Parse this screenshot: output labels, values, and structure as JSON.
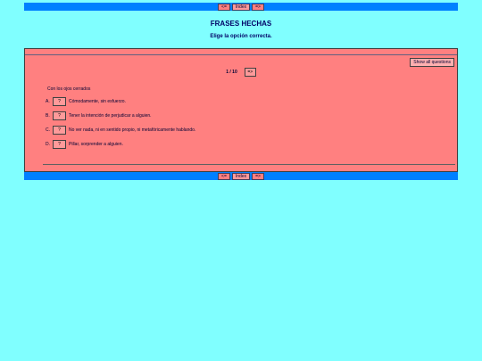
{
  "nav": {
    "prev_label": "<=",
    "index_label": "Index",
    "next_label": "=>"
  },
  "header": {
    "title": "FRASES HECHAS",
    "instruction": "Elige la opción correcta."
  },
  "quiz": {
    "show_all_label": "Show all questions",
    "counter": "1 / 10",
    "next_label": "=>",
    "question": "Con los ojos cerrados",
    "answers": [
      {
        "letter": "A.",
        "button": "?",
        "text": "Cómodamente, sin esfuerzo."
      },
      {
        "letter": "B.",
        "button": "?",
        "text": "Tener la intención de perjudicar a alguien."
      },
      {
        "letter": "C.",
        "button": "?",
        "text": "No ver nada, ni en sentido propio, ni metafóricamente hablando."
      },
      {
        "letter": "D.",
        "button": "?",
        "text": "Pillar, sorprender a alguien."
      }
    ]
  },
  "colors": {
    "background": "#80ffff",
    "navbar": "#0080ff",
    "panel": "#ff8080",
    "text": "#000066"
  }
}
